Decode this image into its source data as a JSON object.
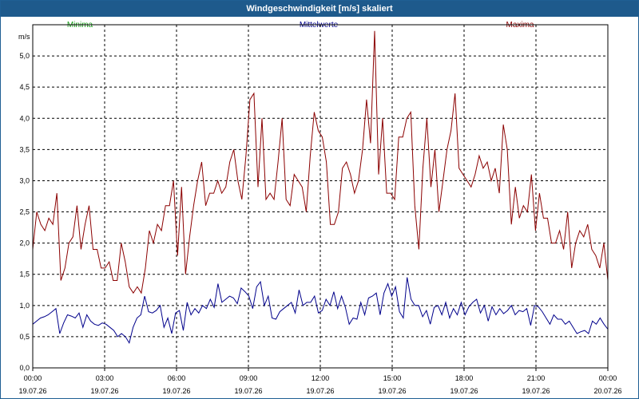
{
  "window": {
    "title": "Windgeschwindigkeit [m/s] skaliert"
  },
  "legend": {
    "min": "Minima",
    "mean": "Mittelwerte",
    "max": "Maxima"
  },
  "colors": {
    "min": "#1a9e1a",
    "mean": "#00008b",
    "max": "#8b0000",
    "title_bar": "#1e5a8c"
  },
  "chart_data": {
    "type": "line",
    "title": "Windgeschwindigkeit [m/s] skaliert",
    "ylabel": "m/s",
    "xlabel": "",
    "ylim": [
      0,
      5.5
    ],
    "y_ticks": [
      "0,0",
      "0,5",
      "1,0",
      "1,5",
      "2,0",
      "2,5",
      "3,0",
      "3,5",
      "4,0",
      "4,5",
      "5,0"
    ],
    "x_range": [
      "19.07.26 00:00",
      "20.07.26 00:00"
    ],
    "x_ticks": [
      {
        "time": "00:00",
        "date": "19.07.26"
      },
      {
        "time": "03:00",
        "date": "19.07.26"
      },
      {
        "time": "06:00",
        "date": "19.07.26"
      },
      {
        "time": "09:00",
        "date": "19.07.26"
      },
      {
        "time": "12:00",
        "date": "19.07.26"
      },
      {
        "time": "15:00",
        "date": "19.07.26"
      },
      {
        "time": "18:00",
        "date": "19.07.26"
      },
      {
        "time": "21:00",
        "date": "19.07.26"
      },
      {
        "time": "00:00",
        "date": "20.07.26"
      }
    ],
    "grid": true,
    "legend_position": "top",
    "series": [
      {
        "name": "Minima",
        "interval_minutes": 1440,
        "values": [
          0.0,
          0.0
        ]
      },
      {
        "name": "Mittelwerte",
        "interval_minutes": 10,
        "values": [
          0.7,
          0.75,
          0.8,
          0.82,
          0.85,
          0.9,
          0.95,
          0.55,
          0.72,
          0.85,
          0.83,
          0.8,
          0.88,
          0.65,
          0.85,
          0.75,
          0.7,
          0.68,
          0.72,
          0.7,
          0.65,
          0.6,
          0.5,
          0.55,
          0.5,
          0.4,
          0.65,
          0.8,
          0.85,
          1.15,
          0.9,
          0.88,
          0.92,
          1.0,
          0.65,
          0.8,
          0.55,
          0.88,
          0.92,
          0.6,
          1.05,
          0.85,
          0.95,
          0.88,
          1.0,
          0.95,
          1.1,
          0.97,
          1.35,
          1.05,
          1.1,
          1.15,
          1.12,
          1.03,
          1.28,
          1.22,
          1.15,
          0.95,
          1.3,
          1.38,
          1.0,
          1.15,
          0.8,
          0.78,
          0.9,
          0.95,
          1.0,
          1.05,
          0.88,
          1.25,
          1.0,
          1.05,
          1.05,
          1.15,
          0.88,
          0.92,
          1.1,
          1.0,
          1.22,
          0.95,
          1.15,
          0.97,
          0.7,
          0.8,
          0.78,
          1.05,
          0.85,
          1.12,
          1.15,
          1.2,
          0.85,
          1.2,
          1.35,
          1.15,
          1.3,
          0.9,
          0.8,
          1.45,
          1.1,
          1.0,
          1.0,
          0.82,
          0.92,
          0.7,
          0.97,
          1.0,
          0.85,
          1.05,
          0.8,
          0.95,
          0.85,
          1.05,
          0.85,
          0.98,
          1.05,
          1.1,
          0.88,
          1.0,
          0.75,
          0.98,
          0.85,
          0.95,
          0.87,
          0.92,
          1.0,
          0.85,
          0.92,
          0.9,
          0.95,
          0.68,
          1.0,
          0.98,
          0.9,
          0.8,
          0.7,
          0.85,
          0.78,
          0.78,
          0.7,
          0.75,
          0.65,
          0.55,
          0.58,
          0.6,
          0.55,
          0.75,
          0.7,
          0.8,
          0.7,
          0.62
        ]
      },
      {
        "name": "Maxima",
        "interval_minutes": 10,
        "values": [
          1.9,
          2.5,
          2.3,
          2.2,
          2.4,
          2.3,
          2.8,
          1.4,
          1.6,
          2.0,
          2.1,
          2.6,
          1.9,
          2.3,
          2.6,
          1.9,
          1.9,
          1.6,
          1.6,
          1.7,
          1.4,
          1.4,
          2.0,
          1.7,
          1.3,
          1.2,
          1.3,
          1.2,
          1.6,
          2.2,
          2.0,
          2.3,
          2.2,
          2.6,
          2.6,
          3.0,
          1.8,
          2.9,
          1.5,
          2.1,
          2.6,
          3.0,
          3.3,
          2.6,
          2.8,
          2.8,
          3.0,
          2.8,
          2.9,
          3.3,
          3.5,
          3.0,
          2.7,
          3.4,
          4.3,
          4.4,
          2.9,
          4.0,
          2.7,
          2.8,
          2.7,
          3.3,
          4.0,
          2.7,
          2.6,
          3.1,
          3.0,
          2.9,
          2.5,
          3.4,
          4.1,
          3.8,
          3.7,
          3.3,
          2.3,
          2.3,
          2.5,
          3.2,
          3.3,
          3.1,
          2.8,
          3.0,
          3.5,
          4.3,
          3.6,
          5.4,
          3.1,
          4.0,
          2.8,
          2.8,
          2.7,
          3.7,
          3.7,
          4.0,
          4.1,
          2.6,
          1.9,
          3.2,
          4.0,
          2.9,
          3.5,
          2.5,
          3.0,
          3.5,
          3.8,
          4.4,
          3.2,
          3.1,
          3.0,
          2.9,
          3.1,
          3.4,
          3.2,
          3.3,
          3.0,
          3.2,
          2.8,
          3.9,
          3.5,
          2.3,
          2.9,
          2.4,
          2.6,
          2.5,
          3.1,
          2.2,
          2.8,
          2.4,
          2.4,
          2.0,
          2.0,
          2.2,
          1.9,
          2.5,
          1.6,
          2.0,
          2.2,
          2.1,
          2.3,
          1.9,
          1.8,
          1.6,
          2.0,
          1.4
        ]
      }
    ]
  }
}
